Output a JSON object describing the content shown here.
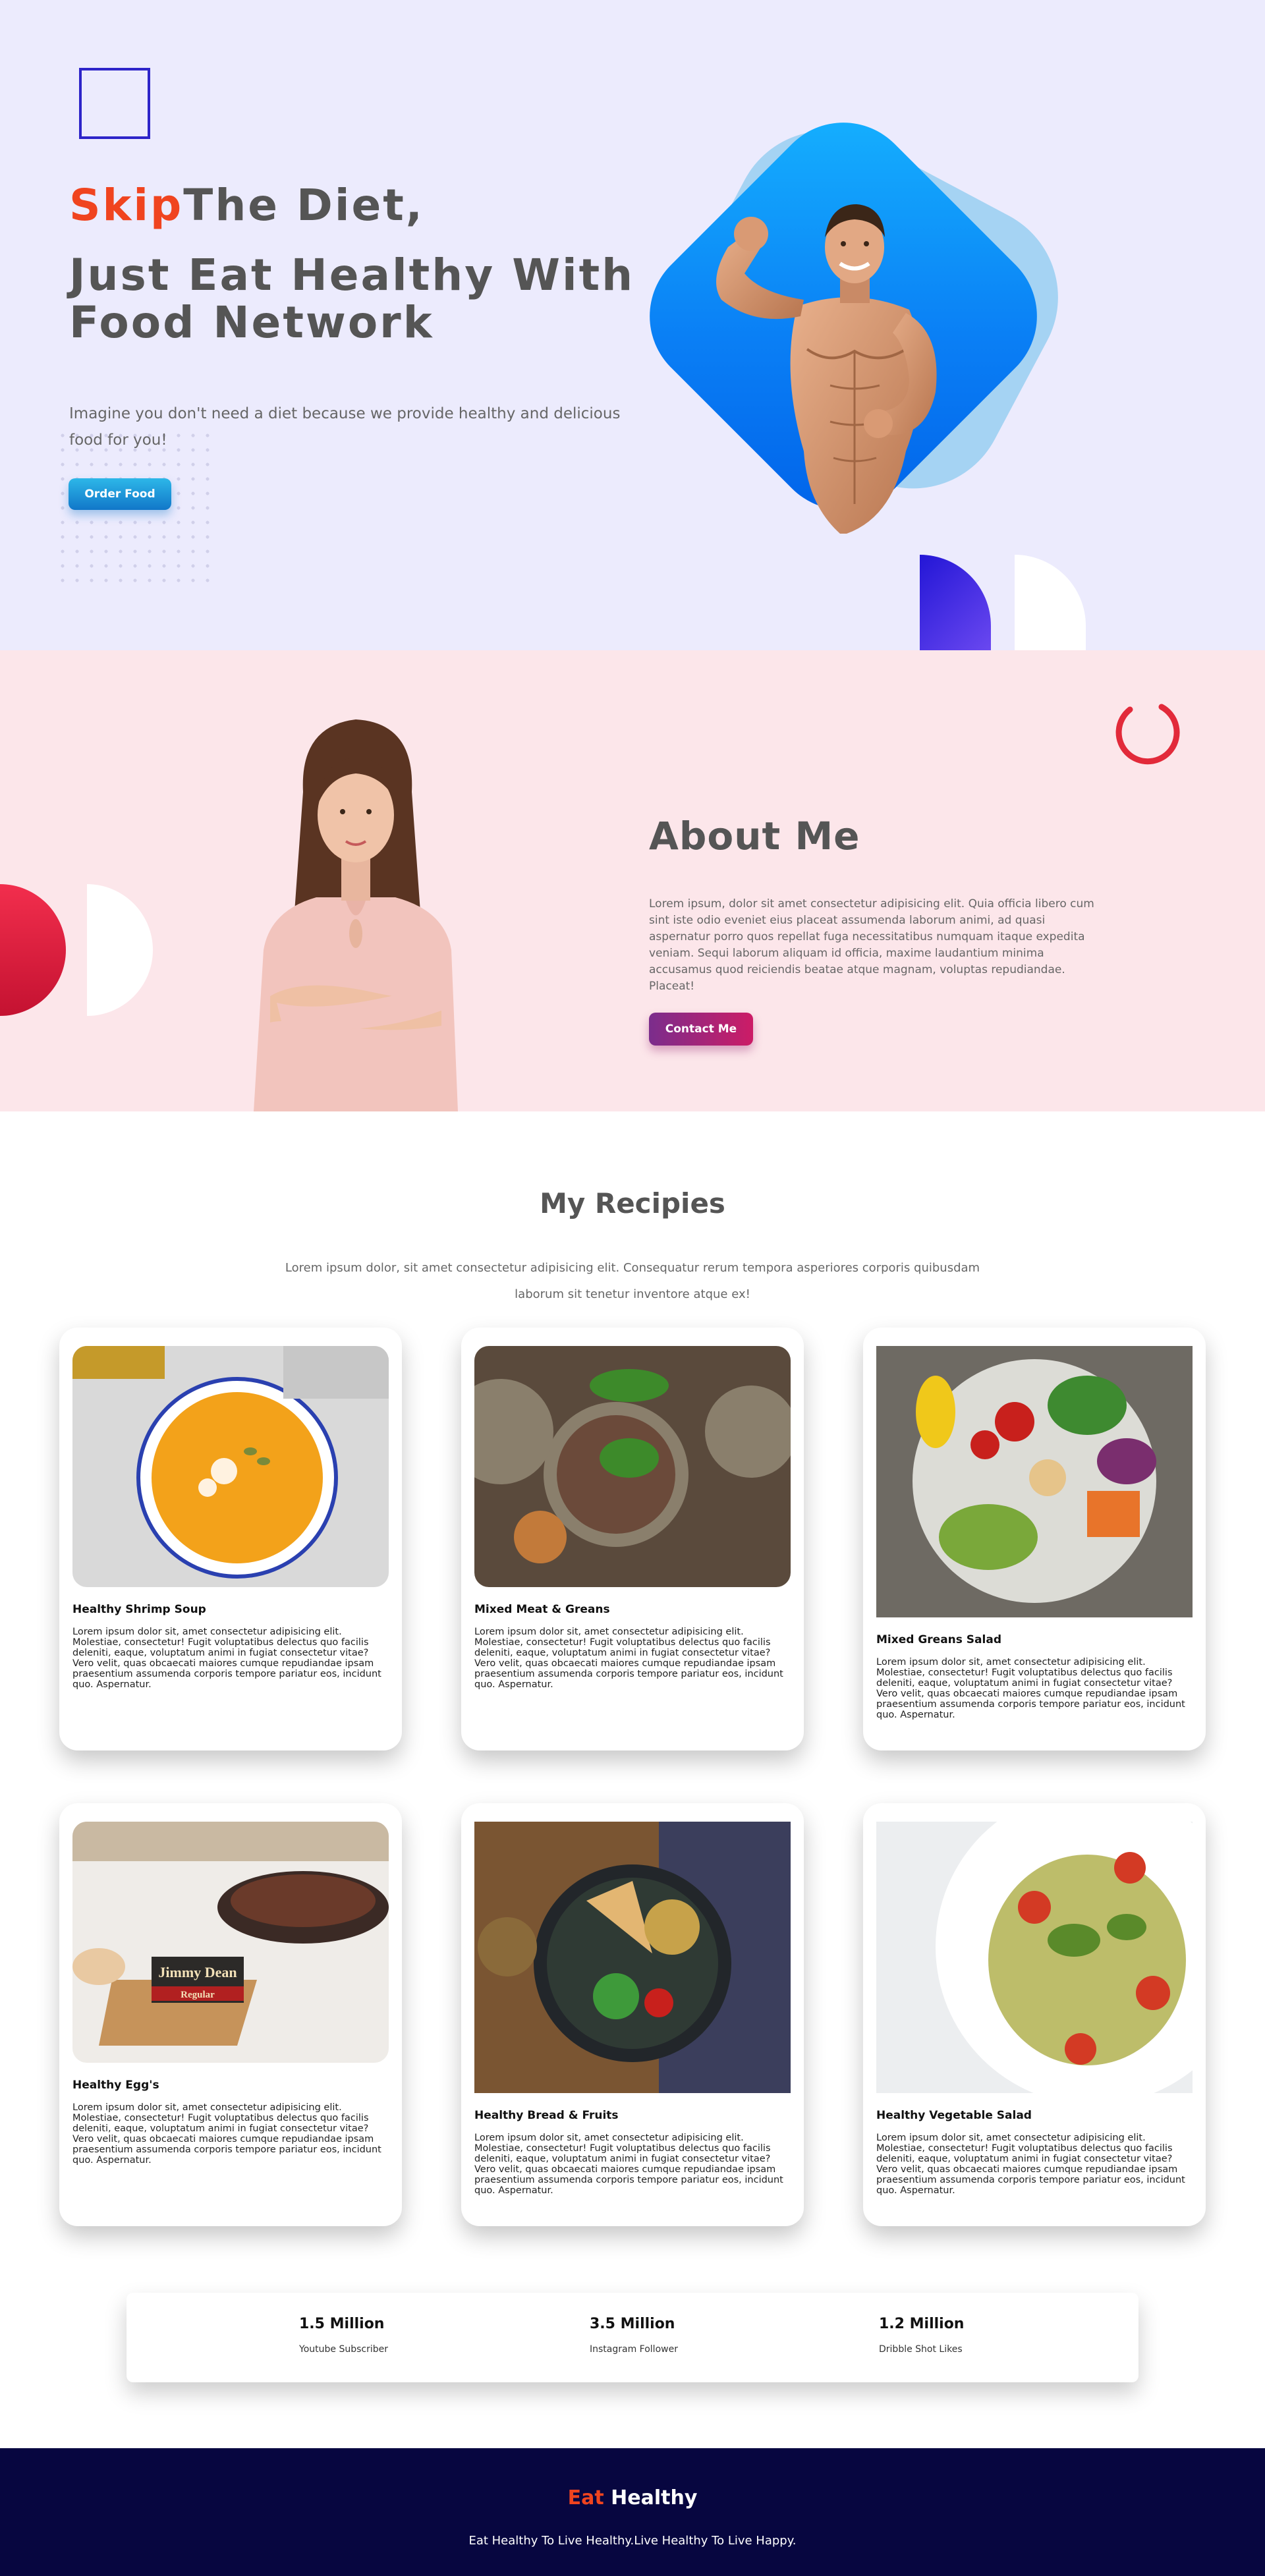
{
  "hero": {
    "title_highlight": "Skip",
    "title_rest": "The  Diet,",
    "title_line2": "Just  Eat  Healthy  With Food  Network",
    "description": "Imagine you don't need a diet because we provide healthy and delicious food for you!",
    "cta_label": "Order Food"
  },
  "about": {
    "title": "About Me",
    "text": "Lorem ipsum, dolor sit amet consectetur adipisicing elit. Quia officia libero cum sint iste odio eveniet eius placeat assumenda laborum animi, ad quasi aspernatur porro quos repellat fuga necessitatibus numquam itaque expedita veniam. Sequi laborum aliquam id officia, maxime laudantium minima accusamus quod reiciendis beatae atque magnam, voluptas repudiandae. Placeat!",
    "cta_label": "Contact Me"
  },
  "recipes": {
    "title": "My Recipies",
    "subtitle": "Lorem ipsum dolor, sit amet consectetur adipisicing elit. Consequatur rerum tempora asperiores corporis quibusdam laborum sit tenetur inventore atque ex!",
    "cards": [
      {
        "name": "Healthy Shrimp Soup",
        "desc": "Lorem ipsum dolor sit, amet consectetur adipisicing elit. Molestiae, consectetur! Fugit voluptatibus delectus quo facilis deleniti, eaque, voluptatum animi in fugiat consectetur vitae? Vero velit, quas obcaecati maiores cumque repudiandae ipsam praesentium assumenda corporis tempore pariatur eos, incidunt quo. Aspernatur."
      },
      {
        "name": "Mixed Meat & Greans",
        "desc": "Lorem ipsum dolor sit, amet consectetur adipisicing elit. Molestiae, consectetur! Fugit voluptatibus delectus quo facilis deleniti, eaque, voluptatum animi in fugiat consectetur vitae? Vero velit, quas obcaecati maiores cumque repudiandae ipsam praesentium assumenda corporis tempore pariatur eos, incidunt quo. Aspernatur."
      },
      {
        "name": "Mixed Greans Salad",
        "desc": "Lorem ipsum dolor sit, amet consectetur adipisicing elit. Molestiae, consectetur! Fugit voluptatibus delectus quo facilis deleniti, eaque, voluptatum animi in fugiat consectetur vitae? Vero velit, quas obcaecati maiores cumque repudiandae ipsam praesentium assumenda corporis tempore pariatur eos, incidunt quo. Aspernatur."
      },
      {
        "name": "Healthy Egg's",
        "desc": "Lorem ipsum dolor sit, amet consectetur adipisicing elit. Molestiae, consectetur! Fugit voluptatibus delectus quo facilis deleniti, eaque, voluptatum animi in fugiat consectetur vitae? Vero velit, quas obcaecati maiores cumque repudiandae ipsam praesentium assumenda corporis tempore pariatur eos, incidunt quo. Aspernatur.",
        "package_text": "Jimmy Dean",
        "package_sub": "Regular"
      },
      {
        "name": "Healthy Bread & Fruits",
        "desc": "Lorem ipsum dolor sit, amet consectetur adipisicing elit. Molestiae, consectetur! Fugit voluptatibus delectus quo facilis deleniti, eaque, voluptatum animi in fugiat consectetur vitae? Vero velit, quas obcaecati maiores cumque repudiandae ipsam praesentium assumenda corporis tempore pariatur eos, incidunt quo. Aspernatur."
      },
      {
        "name": "Healthy Vegetable Salad",
        "desc": "Lorem ipsum dolor sit, amet consectetur adipisicing elit. Molestiae, consectetur! Fugit voluptatibus delectus quo facilis deleniti, eaque, voluptatum animi in fugiat consectetur vitae? Vero velit, quas obcaecati maiores cumque repudiandae ipsam praesentium assumenda corporis tempore pariatur eos, incidunt quo. Aspernatur."
      }
    ]
  },
  "stats": [
    {
      "value": "1.5 Million",
      "label": "Youtube Subscriber"
    },
    {
      "value": "3.5 Million",
      "label": "Instagram Follower"
    },
    {
      "value": "1.2 Million",
      "label": "Dribble Shot Likes"
    }
  ],
  "footer": {
    "brand_accent": "Eat",
    "brand_rest": "Healthy",
    "tagline": "Eat Healthy To Live Healthy.Live Healthy To Live Happy."
  },
  "colors": {
    "accent": "#f0441f",
    "hero_bg": "#ecebfd",
    "about_bg": "#fce6ea",
    "footer_bg": "#070640"
  }
}
